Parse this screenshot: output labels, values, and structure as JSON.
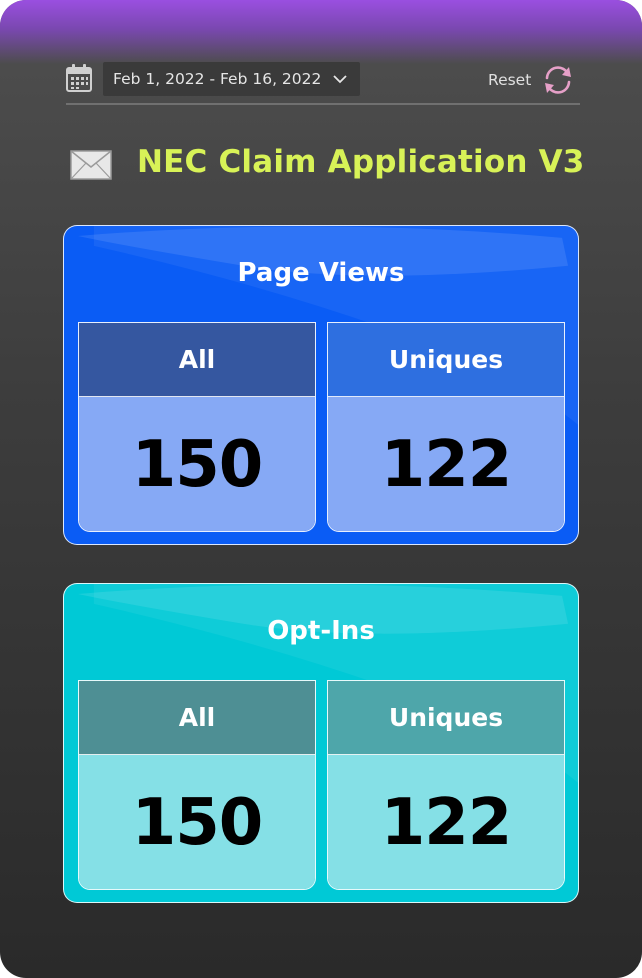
{
  "header": {
    "date_range": "Feb 1, 2022 - Feb 16, 2022",
    "reset_label": "Reset"
  },
  "title": "NEC Claim Application V3",
  "icons": {
    "calendar": "calendar-icon",
    "dropdown": "chevron-down-icon",
    "reset": "refresh-icon",
    "title": "mail-icon"
  },
  "cards": {
    "page_views": {
      "title": "Page Views",
      "all_label": "All",
      "all_value": "150",
      "uniques_label": "Uniques",
      "uniques_value": "122"
    },
    "opt_ins": {
      "title": "Opt-Ins",
      "all_label": "All",
      "all_value": "150",
      "uniques_label": "Uniques",
      "uniques_value": "122"
    }
  },
  "colors": {
    "title_text": "#d8f257",
    "page_views_card": "#0a5cf5",
    "opt_ins_card": "#00c9d6",
    "top_accent": "#9a4fe0"
  }
}
